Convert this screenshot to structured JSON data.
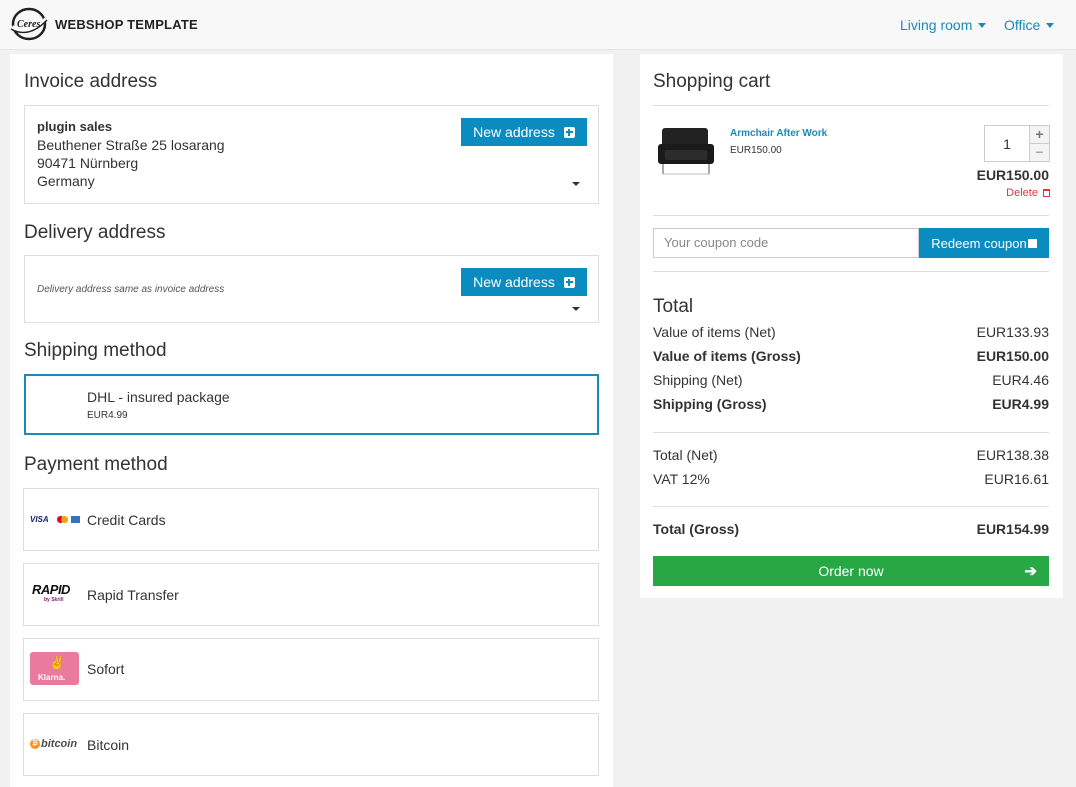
{
  "header": {
    "brand": "WEBSHOP TEMPLATE",
    "logo_text": "Ceres",
    "nav": [
      "Living room",
      "Office"
    ]
  },
  "invoice": {
    "title": "Invoice address",
    "name": "plugin sales",
    "street": "Beuthener Straße 25 losarang",
    "city": "90471 Nürnberg",
    "country": "Germany",
    "new_address_label": "New address"
  },
  "delivery": {
    "title": "Delivery address",
    "note": "Delivery address same as invoice address",
    "new_address_label": "New address"
  },
  "shipping": {
    "title": "Shipping method",
    "name": "DHL - insured package",
    "price": "EUR4.99"
  },
  "payment": {
    "title": "Payment method",
    "methods": [
      "Credit Cards",
      "Rapid Transfer",
      "Sofort",
      "Bitcoin"
    ],
    "logos": {
      "visa": "VISA",
      "rapid": "RAPID",
      "rapid_sub": "by Skrill",
      "klarna": "Klarna.",
      "bitcoin": "bitcoin"
    }
  },
  "cart": {
    "title": "Shopping cart",
    "item": {
      "name": "Armchair After Work",
      "price": "EUR150.00",
      "quantity": "1",
      "total": "EUR150.00",
      "delete_label": "Delete"
    },
    "coupon_placeholder": "Your coupon code",
    "redeem_label": "Redeem coupon"
  },
  "totals": {
    "title": "Total",
    "items_net_label": "Value of items (Net)",
    "items_net": "EUR133.93",
    "items_gross_label": "Value of items (Gross)",
    "items_gross": "EUR150.00",
    "shipping_net_label": "Shipping (Net)",
    "shipping_net": "EUR4.46",
    "shipping_gross_label": "Shipping (Gross)",
    "shipping_gross": "EUR4.99",
    "total_net_label": "Total (Net)",
    "total_net": "EUR138.38",
    "vat_label": "VAT 12%",
    "vat": "EUR16.61",
    "total_gross_label": "Total (Gross)",
    "total_gross": "EUR154.99",
    "order_label": "Order now"
  },
  "colors": {
    "accent": "#0b8cc0",
    "link": "#1b8ab8",
    "order": "#28a745",
    "delete": "#e0353b"
  }
}
